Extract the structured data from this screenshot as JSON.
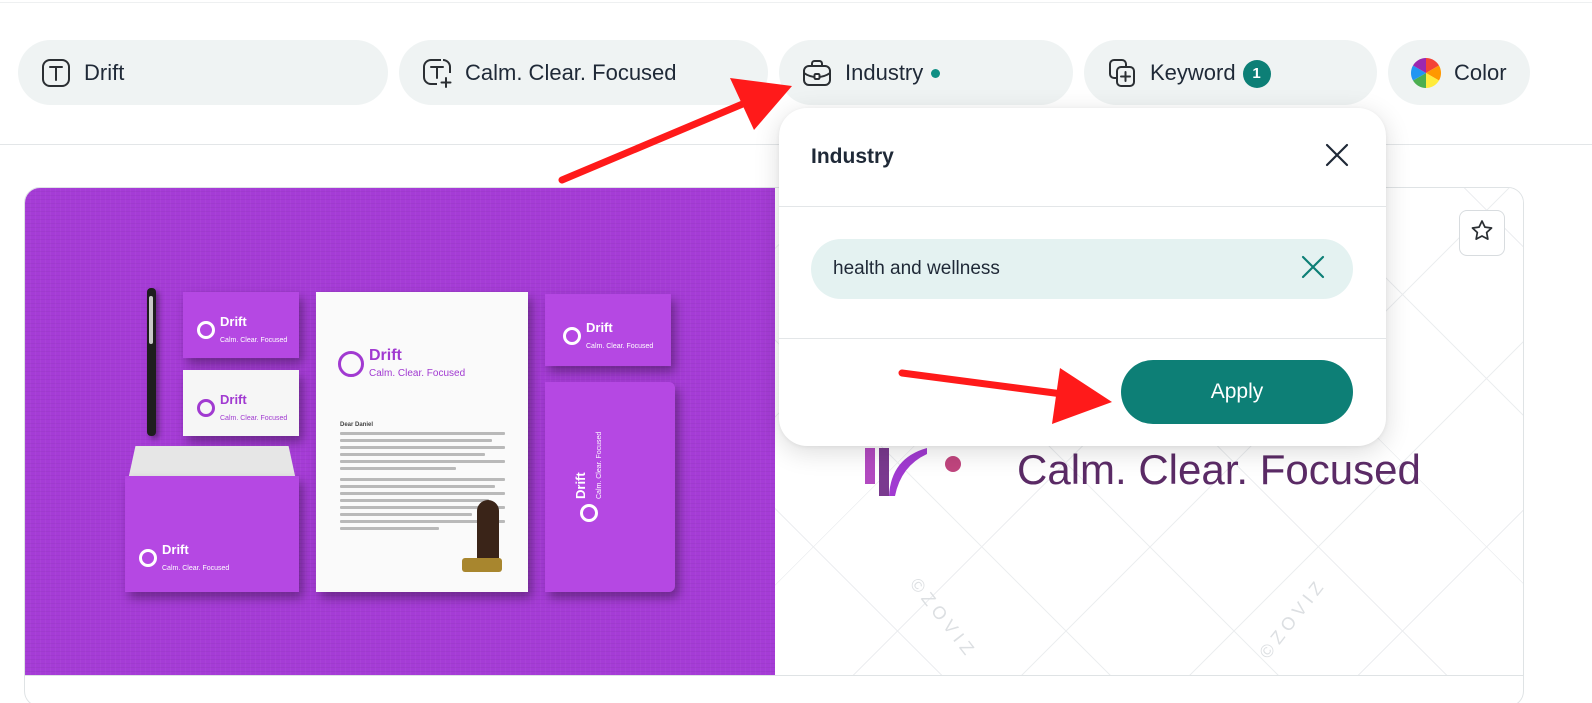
{
  "filters": {
    "chips": [
      {
        "label": "Drift",
        "icon": "text-icon"
      },
      {
        "label": "Calm. Clear. Focused",
        "icon": "text-add-icon"
      },
      {
        "label": "Industry",
        "icon": "briefcase-icon",
        "indicator": "active-dot"
      },
      {
        "label": "Keyword",
        "icon": "copy-add-icon",
        "badge": "1"
      },
      {
        "label": "Color",
        "icon": "color-wheel-icon"
      }
    ]
  },
  "preview": {
    "mockup": {
      "brand_name": "Drift",
      "brand_tagline": "Calm. Clear. Focused",
      "letter_greeting": "Dear Daniel"
    },
    "tagline": "Calm. Clear. Focused",
    "watermark": "©ZOVIZ"
  },
  "popover": {
    "title": "Industry",
    "input_value": "health and wellness",
    "apply_label": "Apply"
  },
  "colors": {
    "accent": "#0d7f76",
    "chip_bg": "#eff3f3",
    "input_bg": "#e4f2f1",
    "mockup_bg": "#a53cd6",
    "annotation_arrow": "#ff1a1a"
  }
}
